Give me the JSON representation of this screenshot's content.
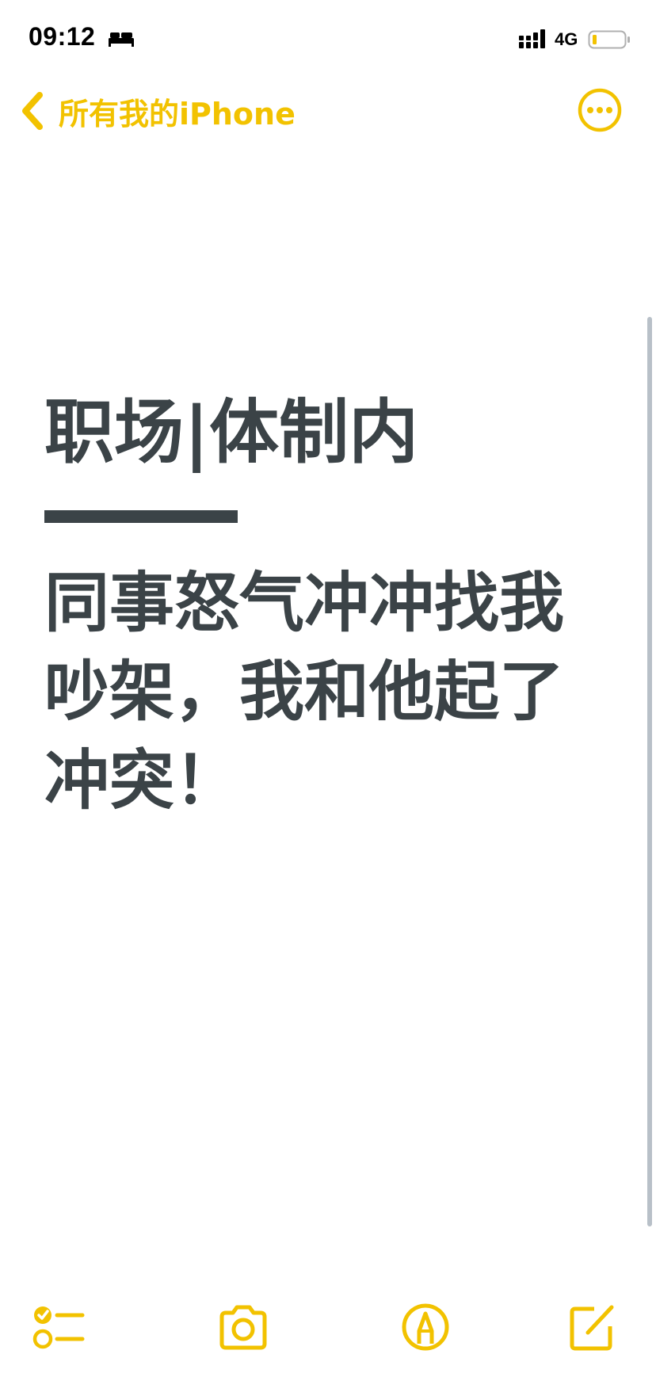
{
  "status_bar": {
    "time": "09:12",
    "network": "4G",
    "icons": [
      "bed-icon",
      "signal-icon",
      "battery-icon"
    ]
  },
  "nav": {
    "back_label": "所有我的iPhone",
    "back_icon": "chevron-left-icon",
    "more_icon": "ellipsis-circle-icon"
  },
  "note": {
    "title": "职场|体制内",
    "body": "同事怒气冲冲找我吵架，我和他起了冲突！"
  },
  "toolbar": {
    "items": [
      "checklist-icon",
      "camera-icon",
      "markup-icon",
      "compose-icon"
    ]
  },
  "colors": {
    "accent": "#f2c200",
    "text": "#3b4347",
    "background": "#ffffff"
  }
}
